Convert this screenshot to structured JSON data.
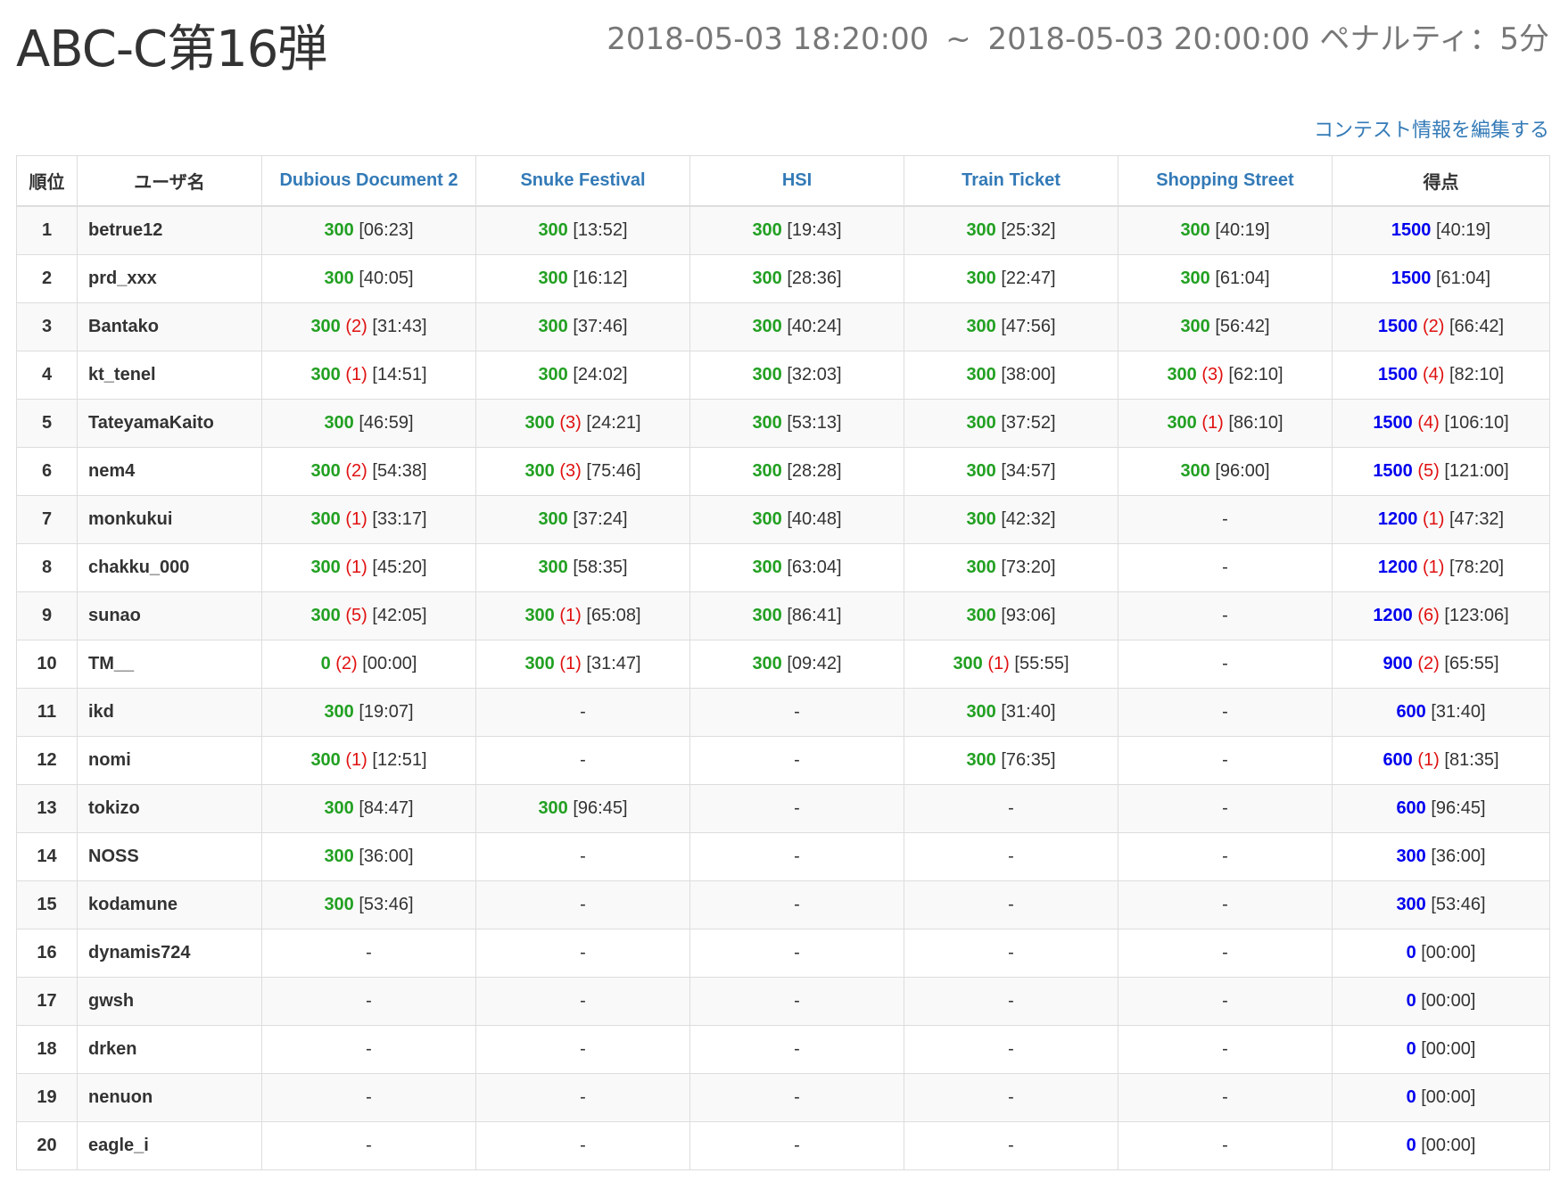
{
  "contest": {
    "title": "ABC-C第16弾",
    "start": "2018-05-03 18:20:00",
    "separator": "~",
    "end": "2018-05-03 20:00:00",
    "penalty": "ペナルティ：5分",
    "edit_link": "コンテスト情報を編集する"
  },
  "colors": {
    "points": "#22a022",
    "total": "#0000ee",
    "penalty": "#e01010",
    "link": "#337ab7"
  },
  "table": {
    "headers": {
      "rank": "順位",
      "user": "ユーザ名",
      "problems": [
        "Dubious Document 2",
        "Snuke Festival",
        "HSI",
        "Train Ticket",
        "Shopping Street"
      ],
      "total": "得点"
    },
    "rows": [
      {
        "rank": "1",
        "user": "betrue12",
        "cells": [
          {
            "p": "300",
            "t": "[06:23]"
          },
          {
            "p": "300",
            "t": "[13:52]"
          },
          {
            "p": "300",
            "t": "[19:43]"
          },
          {
            "p": "300",
            "t": "[25:32]"
          },
          {
            "p": "300",
            "t": "[40:19]"
          }
        ],
        "total": {
          "p": "1500",
          "t": "[40:19]"
        }
      },
      {
        "rank": "2",
        "user": "prd_xxx",
        "cells": [
          {
            "p": "300",
            "t": "[40:05]"
          },
          {
            "p": "300",
            "t": "[16:12]"
          },
          {
            "p": "300",
            "t": "[28:36]"
          },
          {
            "p": "300",
            "t": "[22:47]"
          },
          {
            "p": "300",
            "t": "[61:04]"
          }
        ],
        "total": {
          "p": "1500",
          "t": "[61:04]"
        }
      },
      {
        "rank": "3",
        "user": "Bantako",
        "cells": [
          {
            "p": "300",
            "w": "(2)",
            "t": "[31:43]"
          },
          {
            "p": "300",
            "t": "[37:46]"
          },
          {
            "p": "300",
            "t": "[40:24]"
          },
          {
            "p": "300",
            "t": "[47:56]"
          },
          {
            "p": "300",
            "t": "[56:42]"
          }
        ],
        "total": {
          "p": "1500",
          "w": "(2)",
          "t": "[66:42]"
        }
      },
      {
        "rank": "4",
        "user": "kt_tenel",
        "cells": [
          {
            "p": "300",
            "w": "(1)",
            "t": "[14:51]"
          },
          {
            "p": "300",
            "t": "[24:02]"
          },
          {
            "p": "300",
            "t": "[32:03]"
          },
          {
            "p": "300",
            "t": "[38:00]"
          },
          {
            "p": "300",
            "w": "(3)",
            "t": "[62:10]"
          }
        ],
        "total": {
          "p": "1500",
          "w": "(4)",
          "t": "[82:10]"
        }
      },
      {
        "rank": "5",
        "user": "TateyamaKaito",
        "cells": [
          {
            "p": "300",
            "t": "[46:59]"
          },
          {
            "p": "300",
            "w": "(3)",
            "t": "[24:21]"
          },
          {
            "p": "300",
            "t": "[53:13]"
          },
          {
            "p": "300",
            "t": "[37:52]"
          },
          {
            "p": "300",
            "w": "(1)",
            "t": "[86:10]"
          }
        ],
        "total": {
          "p": "1500",
          "w": "(4)",
          "t": "[106:10]"
        }
      },
      {
        "rank": "6",
        "user": "nem4",
        "cells": [
          {
            "p": "300",
            "w": "(2)",
            "t": "[54:38]"
          },
          {
            "p": "300",
            "w": "(3)",
            "t": "[75:46]"
          },
          {
            "p": "300",
            "t": "[28:28]"
          },
          {
            "p": "300",
            "t": "[34:57]"
          },
          {
            "p": "300",
            "t": "[96:00]"
          }
        ],
        "total": {
          "p": "1500",
          "w": "(5)",
          "t": "[121:00]"
        }
      },
      {
        "rank": "7",
        "user": "monkukui",
        "cells": [
          {
            "p": "300",
            "w": "(1)",
            "t": "[33:17]"
          },
          {
            "p": "300",
            "t": "[37:24]"
          },
          {
            "p": "300",
            "t": "[40:48]"
          },
          {
            "p": "300",
            "t": "[42:32]"
          },
          {
            "d": "-"
          }
        ],
        "total": {
          "p": "1200",
          "w": "(1)",
          "t": "[47:32]"
        }
      },
      {
        "rank": "8",
        "user": "chakku_000",
        "cells": [
          {
            "p": "300",
            "w": "(1)",
            "t": "[45:20]"
          },
          {
            "p": "300",
            "t": "[58:35]"
          },
          {
            "p": "300",
            "t": "[63:04]"
          },
          {
            "p": "300",
            "t": "[73:20]"
          },
          {
            "d": "-"
          }
        ],
        "total": {
          "p": "1200",
          "w": "(1)",
          "t": "[78:20]"
        }
      },
      {
        "rank": "9",
        "user": "sunao",
        "cells": [
          {
            "p": "300",
            "w": "(5)",
            "t": "[42:05]"
          },
          {
            "p": "300",
            "w": "(1)",
            "t": "[65:08]"
          },
          {
            "p": "300",
            "t": "[86:41]"
          },
          {
            "p": "300",
            "t": "[93:06]"
          },
          {
            "d": "-"
          }
        ],
        "total": {
          "p": "1200",
          "w": "(6)",
          "t": "[123:06]"
        }
      },
      {
        "rank": "10",
        "user": "TM__",
        "cells": [
          {
            "p": "0",
            "w": "(2)",
            "t": "[00:00]"
          },
          {
            "p": "300",
            "w": "(1)",
            "t": "[31:47]"
          },
          {
            "p": "300",
            "t": "[09:42]"
          },
          {
            "p": "300",
            "w": "(1)",
            "t": "[55:55]"
          },
          {
            "d": "-"
          }
        ],
        "total": {
          "p": "900",
          "w": "(2)",
          "t": "[65:55]"
        }
      },
      {
        "rank": "11",
        "user": "ikd",
        "cells": [
          {
            "p": "300",
            "t": "[19:07]"
          },
          {
            "d": "-"
          },
          {
            "d": "-"
          },
          {
            "p": "300",
            "t": "[31:40]"
          },
          {
            "d": "-"
          }
        ],
        "total": {
          "p": "600",
          "t": "[31:40]"
        }
      },
      {
        "rank": "12",
        "user": "nomi",
        "cells": [
          {
            "p": "300",
            "w": "(1)",
            "t": "[12:51]"
          },
          {
            "d": "-"
          },
          {
            "d": "-"
          },
          {
            "p": "300",
            "t": "[76:35]"
          },
          {
            "d": "-"
          }
        ],
        "total": {
          "p": "600",
          "w": "(1)",
          "t": "[81:35]"
        }
      },
      {
        "rank": "13",
        "user": "tokizo",
        "cells": [
          {
            "p": "300",
            "t": "[84:47]"
          },
          {
            "p": "300",
            "t": "[96:45]"
          },
          {
            "d": "-"
          },
          {
            "d": "-"
          },
          {
            "d": "-"
          }
        ],
        "total": {
          "p": "600",
          "t": "[96:45]"
        }
      },
      {
        "rank": "14",
        "user": "NOSS",
        "cells": [
          {
            "p": "300",
            "t": "[36:00]"
          },
          {
            "d": "-"
          },
          {
            "d": "-"
          },
          {
            "d": "-"
          },
          {
            "d": "-"
          }
        ],
        "total": {
          "p": "300",
          "t": "[36:00]"
        }
      },
      {
        "rank": "15",
        "user": "kodamune",
        "cells": [
          {
            "p": "300",
            "t": "[53:46]"
          },
          {
            "d": "-"
          },
          {
            "d": "-"
          },
          {
            "d": "-"
          },
          {
            "d": "-"
          }
        ],
        "total": {
          "p": "300",
          "t": "[53:46]"
        }
      },
      {
        "rank": "16",
        "user": "dynamis724",
        "cells": [
          {
            "d": "-"
          },
          {
            "d": "-"
          },
          {
            "d": "-"
          },
          {
            "d": "-"
          },
          {
            "d": "-"
          }
        ],
        "total": {
          "p": "0",
          "t": "[00:00]"
        }
      },
      {
        "rank": "17",
        "user": "gwsh",
        "cells": [
          {
            "d": "-"
          },
          {
            "d": "-"
          },
          {
            "d": "-"
          },
          {
            "d": "-"
          },
          {
            "d": "-"
          }
        ],
        "total": {
          "p": "0",
          "t": "[00:00]"
        }
      },
      {
        "rank": "18",
        "user": "drken",
        "cells": [
          {
            "d": "-"
          },
          {
            "d": "-"
          },
          {
            "d": "-"
          },
          {
            "d": "-"
          },
          {
            "d": "-"
          }
        ],
        "total": {
          "p": "0",
          "t": "[00:00]"
        }
      },
      {
        "rank": "19",
        "user": "nenuon",
        "cells": [
          {
            "d": "-"
          },
          {
            "d": "-"
          },
          {
            "d": "-"
          },
          {
            "d": "-"
          },
          {
            "d": "-"
          }
        ],
        "total": {
          "p": "0",
          "t": "[00:00]"
        }
      },
      {
        "rank": "20",
        "user": "eagle_i",
        "cells": [
          {
            "d": "-"
          },
          {
            "d": "-"
          },
          {
            "d": "-"
          },
          {
            "d": "-"
          },
          {
            "d": "-"
          }
        ],
        "total": {
          "p": "0",
          "t": "[00:00]"
        }
      }
    ]
  }
}
